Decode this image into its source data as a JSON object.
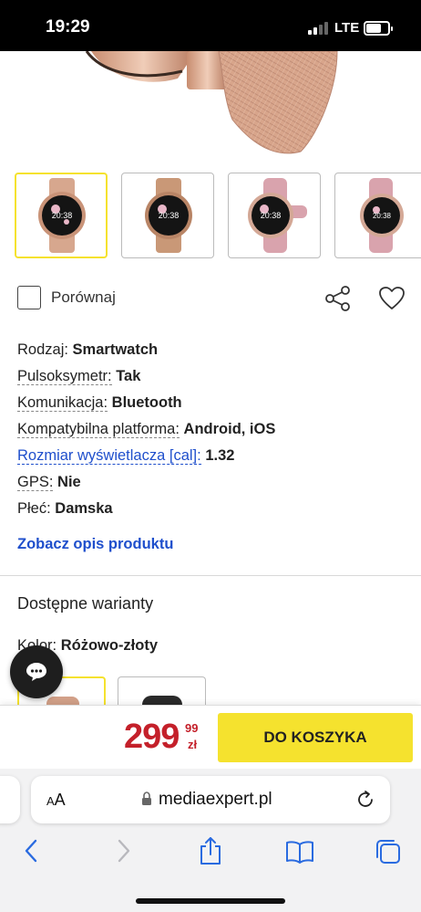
{
  "status_bar": {
    "time": "19:29",
    "network": "LTE",
    "battery_level": 0.7
  },
  "thumbnails": [
    {
      "name": "rose-gold-mesh",
      "selected": true
    },
    {
      "name": "gold-mesh",
      "selected": false
    },
    {
      "name": "pink-silicone",
      "selected": false
    },
    {
      "name": "pink-silicone-2",
      "selected": false
    }
  ],
  "compare": {
    "label": "Porównaj",
    "checked": false
  },
  "specs": [
    {
      "label": "Rodzaj:",
      "value": "Smartwatch",
      "style": "plain"
    },
    {
      "label": "Pulsoksymetr:",
      "value": "Tak",
      "style": "dashed"
    },
    {
      "label": "Komunikacja:",
      "value": "Bluetooth",
      "style": "dashed"
    },
    {
      "label": "Kompatybilna platforma:",
      "value": "Android, iOS",
      "style": "dashed"
    },
    {
      "label": "Rozmiar wyświetlacza [cal]:",
      "value": "1.32",
      "style": "link"
    },
    {
      "label": "GPS:",
      "value": "Nie",
      "style": "dashed"
    },
    {
      "label": "Płeć:",
      "value": "Damska",
      "style": "plain"
    }
  ],
  "see_description": "Zobacz opis produktu",
  "variants": {
    "title": "Dostępne warianty",
    "color_label": "Kolor:",
    "color_value": "Różowo-złoty"
  },
  "cart": {
    "price_main": "299",
    "price_cents": "99",
    "currency": "zł",
    "button_label": "DO KOSZYKA"
  },
  "browser": {
    "aa_small": "A",
    "aa_large": "A",
    "url": "mediaexpert.pl"
  },
  "colors": {
    "accent_yellow": "#f5e22e",
    "price_red": "#c4202a",
    "link_blue": "#1f4fcc",
    "safari_blue": "#2a6be0"
  }
}
